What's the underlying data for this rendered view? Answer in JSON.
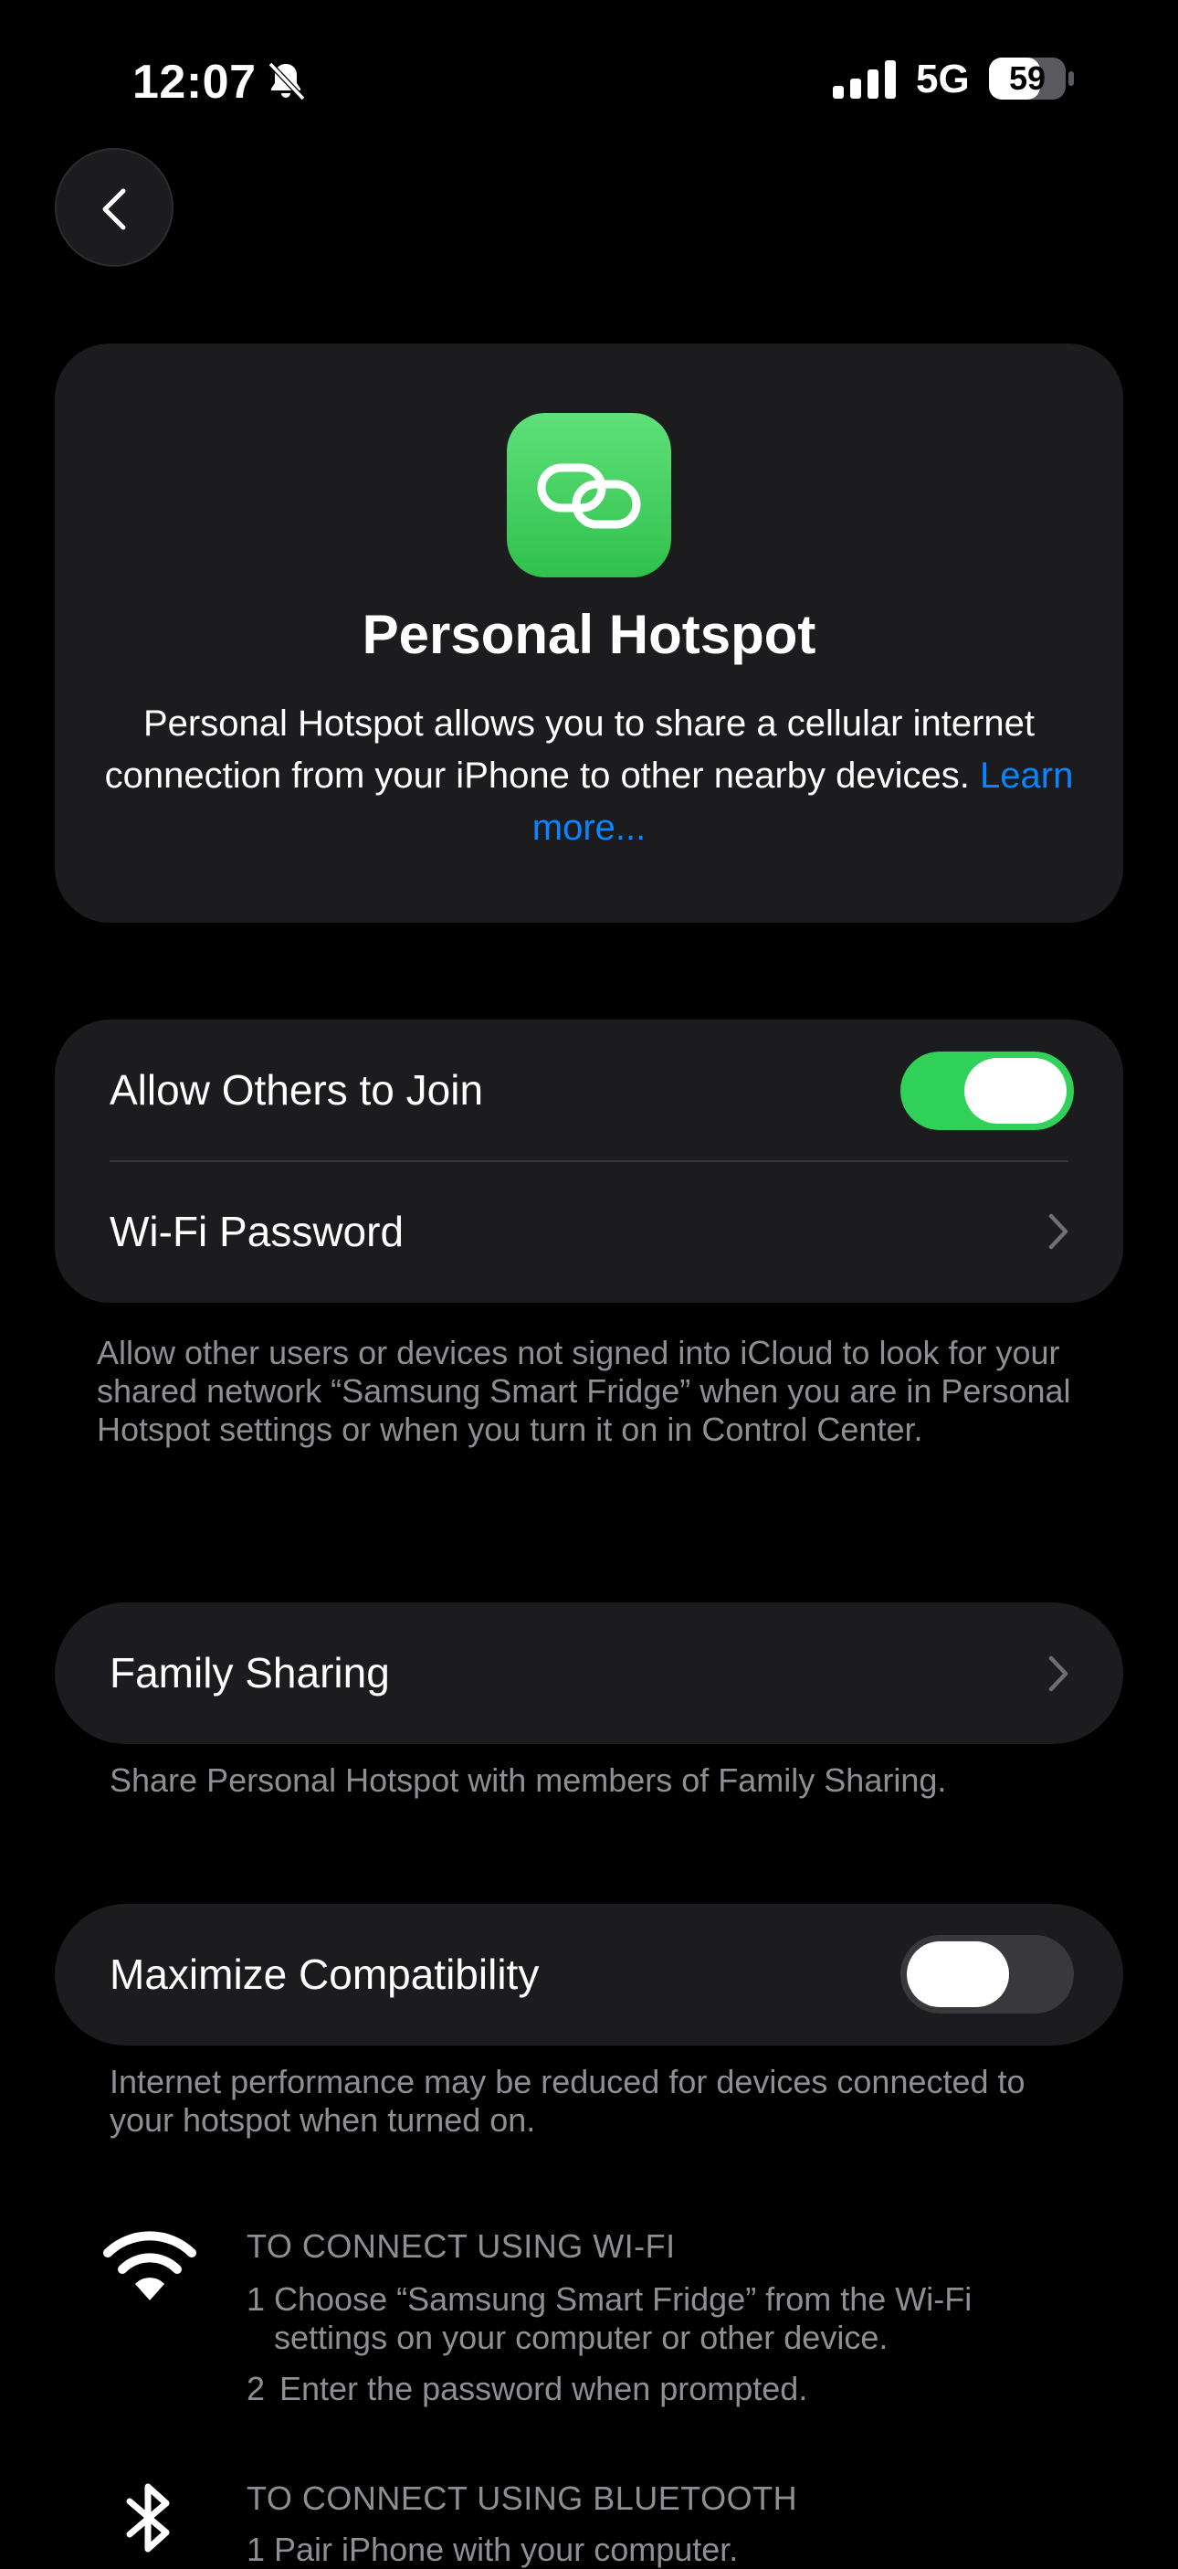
{
  "status_bar": {
    "time": "12:07",
    "network": "5G",
    "battery": "59"
  },
  "header": {
    "title": "Personal Hotspot",
    "description": "Personal Hotspot allows you to share a cellular internet connection from your iPhone to other nearby devices.",
    "learn_more": "Learn more..."
  },
  "settings": {
    "allow_others": {
      "label": "Allow Others to Join",
      "on": true
    },
    "wifi_password": {
      "label": "Wi-Fi Password"
    },
    "allow_footnote": "Allow other users or devices not signed into iCloud to look for your shared network “Samsung Smart Fridge” when you are in Personal Hotspot settings or when you turn it on in Control Center.",
    "family_sharing": {
      "label": "Family Sharing"
    },
    "family_footnote": "Share Personal Hotspot with members of Family Sharing.",
    "maximize": {
      "label": "Maximize Compatibility",
      "on": false
    },
    "maximize_footnote": "Internet performance may be reduced for devices connected to your hotspot when turned on."
  },
  "connect": {
    "wifi": {
      "heading": "TO CONNECT USING WI-FI",
      "step1_num": "1",
      "step1_line1": "Choose “Samsung Smart Fridge” from the Wi-Fi",
      "step1_line2": "settings on your computer or other device.",
      "step2_num": "2",
      "step2": "Enter the password when prompted."
    },
    "bluetooth": {
      "heading": "TO CONNECT USING BLUETOOTH",
      "step1": "1 Pair iPhone with your computer."
    }
  },
  "colors": {
    "background": "#000000",
    "card": "#1c1c1e",
    "accent_green": "#30d158",
    "link_blue": "#0a84ff",
    "secondary_text": "#8e8e93"
  }
}
